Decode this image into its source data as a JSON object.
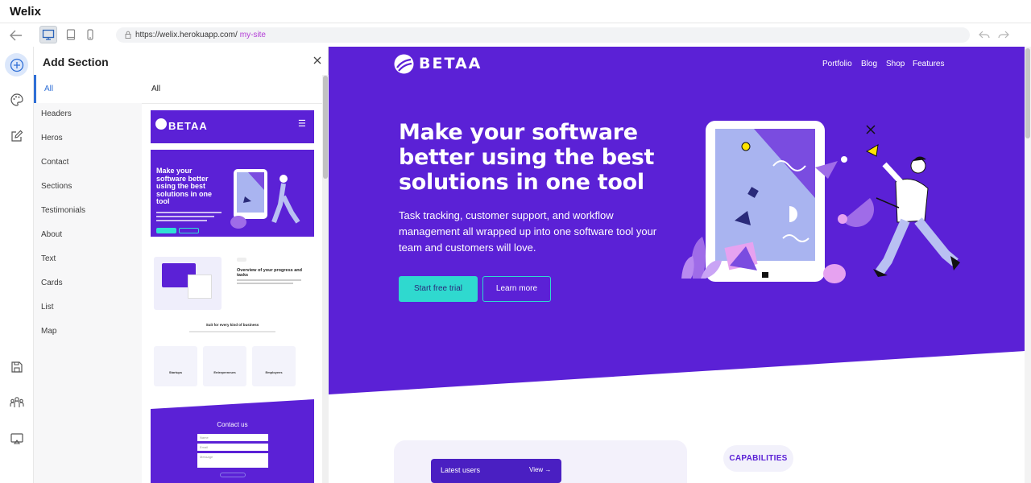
{
  "app": {
    "title": "Welix"
  },
  "toolbar": {
    "url_base": "https://welix.herokuapp.com/",
    "url_site": "my-site",
    "device_modes": [
      "desktop-icon",
      "tablet-icon",
      "mobile-icon"
    ],
    "active_device": "desktop"
  },
  "rail": {
    "items": [
      "add-section-icon",
      "palette-icon",
      "edit-icon",
      "save-icon",
      "team-icon",
      "preview-icon"
    ],
    "active": "add-section-icon"
  },
  "panel": {
    "title": "Add Section",
    "categories": [
      "All",
      "Headers",
      "Heros",
      "Contact",
      "Sections",
      "Testimonials",
      "About",
      "Text",
      "Cards",
      "List",
      "Map"
    ],
    "active_category": "All",
    "thumbs_heading": "All",
    "thumbs": {
      "header_brand": "BETAA",
      "hero_title": "Make your software better using the best solutions in one tool",
      "section_title": "Overview of your progress and tasks",
      "section_sub": "Suit for every kind of business",
      "cards": [
        "Startups",
        "Entrepreneurs",
        "Employees"
      ],
      "contact_title": "Contact us",
      "contact_fields": [
        "Name",
        "Email",
        "Message"
      ]
    }
  },
  "site": {
    "brand": "BETAA",
    "nav": [
      "Portfolio",
      "Blog",
      "Shop",
      "Features"
    ],
    "hero_title": "Make your software better using the best solutions in one tool",
    "hero_subtitle": "Task tracking, customer support, and workflow management all wrapped up into one software tool your team and customers will love.",
    "cta_primary": "Start free trial",
    "cta_secondary": "Learn more",
    "latest_users": "Latest users",
    "latest_view": "View →",
    "capabilities": "CAPABILITIES",
    "colors": {
      "primary": "#5b21d6",
      "accent": "#2fd9cf",
      "link": "#2f6fd6"
    }
  }
}
